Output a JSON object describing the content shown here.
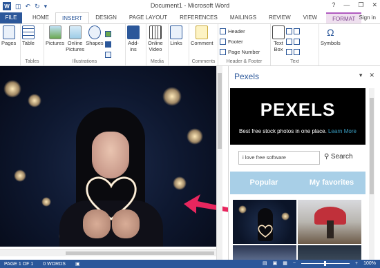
{
  "titlebar": {
    "title": "Document1 - Microsoft Word",
    "app_icon": "W",
    "minimize": "—",
    "restore": "❐",
    "close": "✕",
    "help": "?"
  },
  "tabs": [
    "FILE",
    "HOME",
    "INSERT",
    "DESIGN",
    "PAGE LAYOUT",
    "REFERENCES",
    "MAILINGS",
    "REVIEW",
    "VIEW",
    "FORMAT"
  ],
  "signin": "Sign in",
  "ribbon": {
    "pages": {
      "button": "Pages",
      "group": ""
    },
    "tables": {
      "button": "Table",
      "group": "Tables"
    },
    "illustrations": {
      "pictures": "Pictures",
      "online_pictures_1": "Online",
      "online_pictures_2": "Pictures",
      "shapes": "Shapes",
      "group": "Illustrations"
    },
    "addins": {
      "button_1": "Add-",
      "button_2": "ins"
    },
    "media": {
      "button_1": "Online",
      "button_2": "Video",
      "group": "Media"
    },
    "links": {
      "button": "Links"
    },
    "comments": {
      "button": "Comment",
      "group": "Comments"
    },
    "header_footer": {
      "header": "Header",
      "footer": "Footer",
      "page_number": "Page Number",
      "group": "Header & Footer"
    },
    "text": {
      "text_box_1": "Text",
      "text_box_2": "Box",
      "group": "Text"
    },
    "symbols": {
      "button": "Symbols"
    }
  },
  "pane": {
    "title": "Pexels",
    "logo": "PEXELS",
    "tagline": "Best free stock photos in one place.",
    "learn_more": "Learn More",
    "search_value": "i love free software",
    "search_button": "Search",
    "toggle_popular": "Popular",
    "toggle_favorites": "My favorites"
  },
  "status": {
    "page": "PAGE 1 OF 1",
    "words": "0 WORDS",
    "zoom": "100%",
    "zoom_minus": "−",
    "zoom_plus": "+"
  },
  "colors": {
    "accent": "#2b579a",
    "arrow": "#e8265e",
    "toggle": "#a8cfe7"
  }
}
